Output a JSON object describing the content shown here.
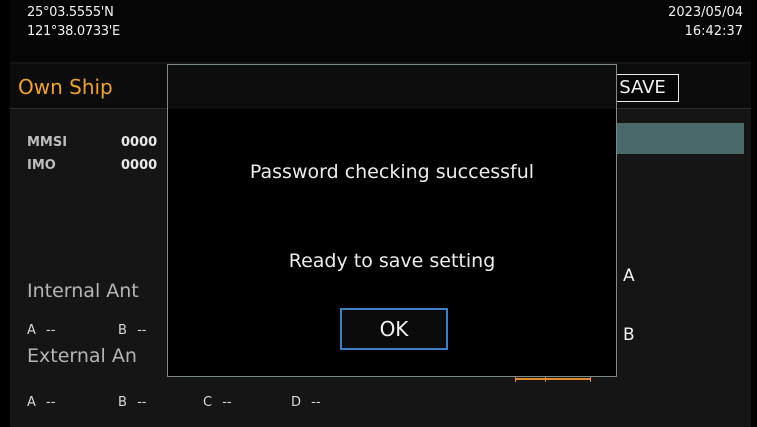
{
  "status": {
    "latitude": "25°03.5555'N",
    "longitude": "121°38.0733'E",
    "date": "2023/05/04",
    "time": "16:42:37"
  },
  "page": {
    "title": "Own Ship",
    "save_label": "SAVE"
  },
  "fields": [
    {
      "label": "MMSI",
      "value": "0000"
    },
    {
      "label": "IMO",
      "value": "0000"
    }
  ],
  "internal_antenna": {
    "title": "Internal Ant",
    "items": [
      {
        "label": "A",
        "value": "--"
      },
      {
        "label": "B",
        "value": "--"
      }
    ]
  },
  "external_antenna": {
    "title": "External An",
    "items": [
      {
        "label": "A",
        "value": "--"
      },
      {
        "label": "B",
        "value": "--"
      },
      {
        "label": "C",
        "value": "--"
      },
      {
        "label": "D",
        "value": "--"
      }
    ]
  },
  "diagram": {
    "mark_a": "A",
    "mark_b": "B"
  },
  "dialog": {
    "message": "Password checking successful",
    "submessage": "Ready to save setting",
    "ok_label": "OK"
  },
  "colors": {
    "accent": "#f0a22b",
    "highlight": "#4a6a6a",
    "focus": "#3c7fc6"
  }
}
